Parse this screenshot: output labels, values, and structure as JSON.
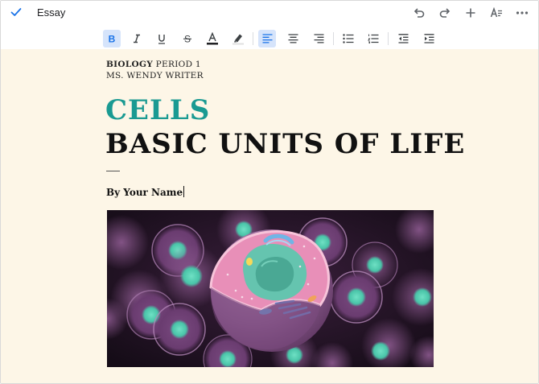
{
  "app": {
    "doc_title": "Essay"
  },
  "icons": {
    "top": [
      "check-icon",
      "undo-icon",
      "redo-icon",
      "add-icon",
      "text-style-icon",
      "more-icon"
    ],
    "format": [
      "bold-icon",
      "italic-icon",
      "underline-icon",
      "strikethrough-icon",
      "text-color-icon",
      "highlight-icon",
      "align-left-icon",
      "align-center-icon",
      "align-right-icon",
      "bulleted-list-icon",
      "numbered-list-icon",
      "decrease-indent-icon",
      "increase-indent-icon"
    ]
  },
  "colors": {
    "accent": "#1a73e8",
    "page_bg": "#fdf6e7",
    "title_accent": "#1a9a92",
    "active_button_bg": "#d6e4fb"
  },
  "document": {
    "subject": "BIOLOGY",
    "period": "PERIOD 1",
    "teacher": "MS. WENDY WRITER",
    "title_line1": "CELLS",
    "title_line2": "BASIC UNITS OF LIFE",
    "byline": "By Your Name"
  },
  "format_state": {
    "bold_active": true,
    "align": "left"
  }
}
